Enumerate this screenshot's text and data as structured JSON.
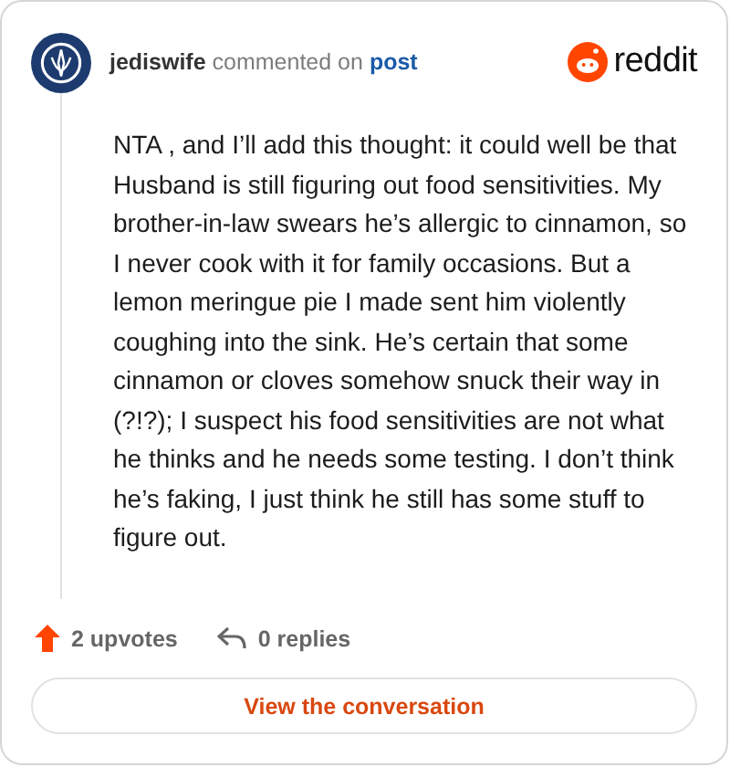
{
  "header": {
    "username": "jediswife",
    "action": "commented on",
    "link": "post",
    "brand": "reddit"
  },
  "comment": "NTA , and I’ll add this thought: it could well be that Husband is still figuring out food sensitivities. My brother-in-law swears he’s allergic to cinnamon, so I never cook with it for family occasions. But a lemon meringue pie I made sent him violently coughing into the sink. He’s certain that some cinnamon or cloves somehow snuck their way in (?!?); I suspect his food sensitivities are not what he thinks and he needs some testing. I don’t think he’s faking, I just think he still has some stuff to figure out.",
  "footer": {
    "upvotes": "2 upvotes",
    "replies": "0 replies"
  },
  "button": "View the conversation"
}
